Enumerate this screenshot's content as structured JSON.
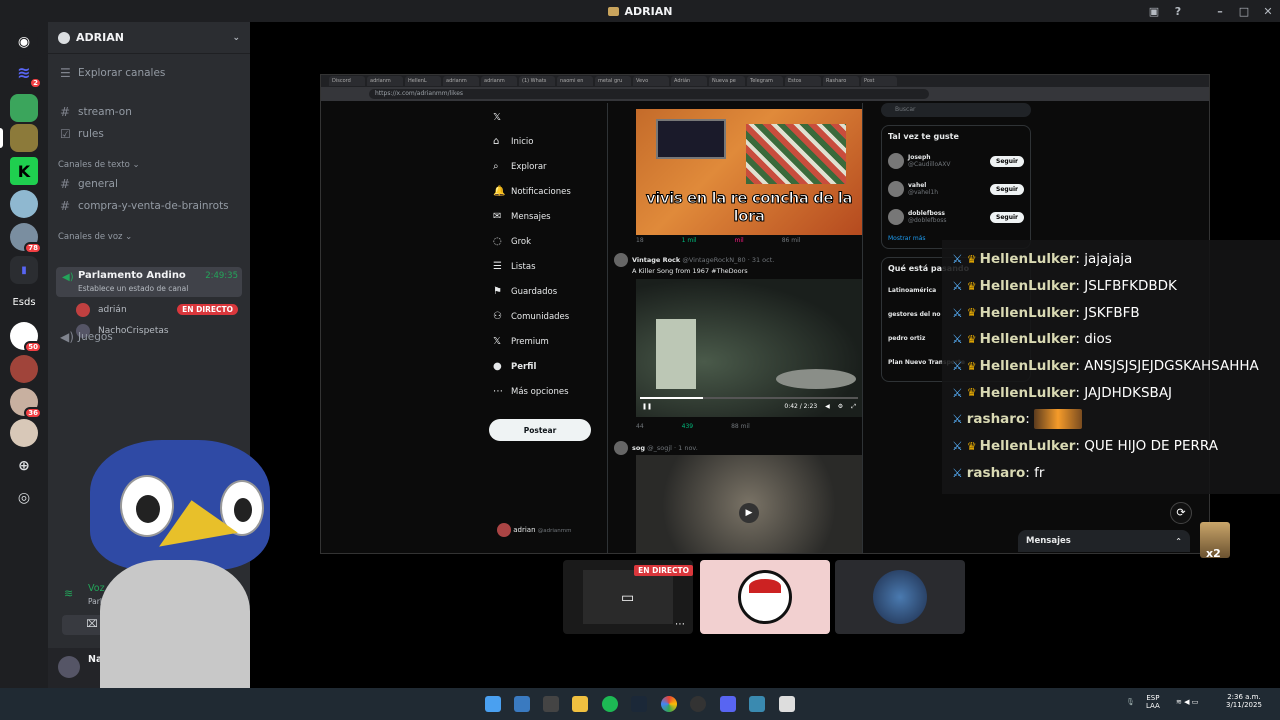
{
  "window": {
    "title": "ADRIAN"
  },
  "server": {
    "name": "ADRIAN",
    "explore_label": "Explorar canales"
  },
  "channels": {
    "top": [
      "stream-on",
      "rules"
    ],
    "text_category": "Canales de texto",
    "text": [
      "general",
      "compra-y-venta-de-brainrots"
    ],
    "voice_category": "Canales de voz",
    "voice_channel": {
      "name": "Parlamento Andino",
      "time": "2:49:35",
      "status": "Establece un estado de canal"
    },
    "voice_users": [
      {
        "name": "adrián",
        "badge": "EN DIRECTO"
      },
      {
        "name": "NachoCrispetas"
      }
    ],
    "games": "Juegos"
  },
  "server_badges": {
    "s1": "2",
    "s2": "78",
    "s3": "50",
    "s4": "36",
    "text_server": "Esds"
  },
  "voice_status": {
    "label": "Voz conectada",
    "channel": "Parlamento Andino"
  },
  "user": {
    "name": "Nacl"
  },
  "browser": {
    "url": "https://x.com/adrianmm/likes",
    "tabs": [
      "Discord",
      "adrianm",
      "HellenL",
      "adrianm",
      "adrianm",
      "(1) Whats",
      "naomi en",
      "metal gru",
      "Vevo",
      "Adrián",
      "Nueva pe",
      "Telegram",
      "Estos",
      "Rasharo",
      "Post"
    ]
  },
  "x": {
    "nav": [
      {
        "icon": "home",
        "label": "Inicio"
      },
      {
        "icon": "search",
        "label": "Explorar"
      },
      {
        "icon": "bell",
        "label": "Notificaciones"
      },
      {
        "icon": "mail",
        "label": "Mensajes"
      },
      {
        "icon": "grok",
        "label": "Grok"
      },
      {
        "icon": "list",
        "label": "Listas"
      },
      {
        "icon": "bookmark",
        "label": "Guardados"
      },
      {
        "icon": "people",
        "label": "Comunidades"
      },
      {
        "icon": "x",
        "label": "Premium"
      },
      {
        "icon": "person",
        "label": "Perfil"
      },
      {
        "icon": "more",
        "label": "Más opciones"
      }
    ],
    "post_button": "Postear",
    "profile": {
      "name": "adrian",
      "handle": "@adrianmm"
    },
    "feed_title": "adrian",
    "post1": {
      "caption": "vivis en la re concha de la lora",
      "replies": "18",
      "retweets": "1 mil",
      "likes": "mil",
      "views": "86 mil"
    },
    "post2": {
      "author": "Vintage Rock",
      "handle": "@VintageRockN_80 · 31 oct.",
      "text": "A Killer Song from 1967 #TheDoors",
      "time": "0:42 / 2:23",
      "replies": "44",
      "retweets": "439",
      "views": "88 mil"
    },
    "post3": {
      "author": "sog",
      "handle": "@_sogjl · 1 nov."
    },
    "search_placeholder": "Buscar",
    "suggestions_title": "Tal vez te guste",
    "suggestions": [
      {
        "name": "Joseph",
        "handle": "@CaudilloAXV",
        "btn": "Seguir"
      },
      {
        "name": "vahel",
        "handle": "@vahel1h",
        "btn": "Seguir"
      },
      {
        "name": "doblefboss",
        "handle": "@doblefboss",
        "btn": "Seguir"
      }
    ],
    "show_more": "Mostrar más",
    "trends_title": "Qué está pasando",
    "trends": [
      "Latinoamérica",
      "gestores del no",
      "pedro ortiz",
      "Plan Nuevo Transporte"
    ],
    "messages_bar": "Mensajes"
  },
  "chat": [
    {
      "user": "HellenLulker",
      "text": ": jajajaja",
      "crown": true
    },
    {
      "user": "HellenLulker",
      "text": ": JSLFBFKDBDK",
      "crown": true
    },
    {
      "user": "HellenLulker",
      "text": ": JSKFBFB",
      "crown": true
    },
    {
      "user": "HellenLulker",
      "text": ": dios",
      "crown": true
    },
    {
      "user": "HellenLulker",
      "text": ": ANSJSJSJEJDGSKAHSAHHA",
      "crown": true
    },
    {
      "user": "HellenLulker",
      "text": ": JAJDHDKSBAJ",
      "crown": true
    },
    {
      "user": "rasharo",
      "text": ":",
      "crown": false,
      "emote": true
    },
    {
      "user": "HellenLulker",
      "text": ": QUE HIJO DE PERRA",
      "crown": true
    },
    {
      "user": "rasharo",
      "text": ": fr",
      "crown": false
    }
  ],
  "overlay_badge": "x2",
  "stream_tile_badge": "EN DIRECTO",
  "taskbar": {
    "lang": "ESP",
    "lang2": "LAA",
    "time": "2:36 a.m.",
    "date": "3/11/2025"
  },
  "colors": {
    "discord_bg": "#2b2d31",
    "live_red": "#da373c",
    "voice_green": "#23a55a",
    "chat_name": "#d9d9b3"
  }
}
